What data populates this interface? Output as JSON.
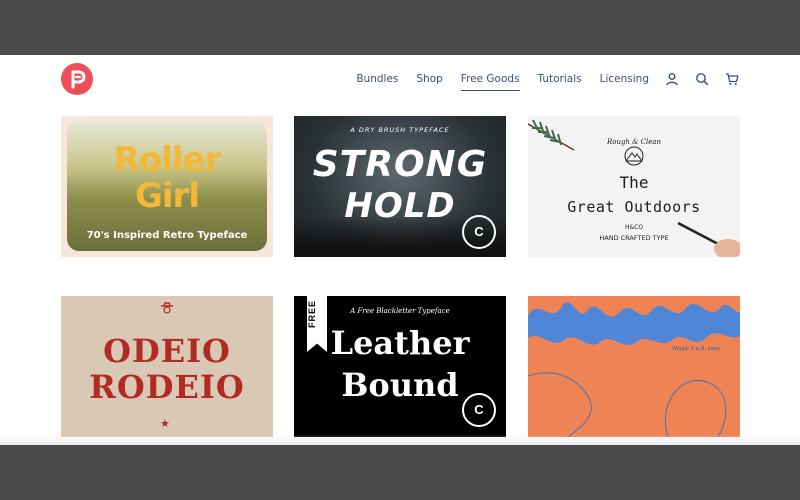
{
  "header": {
    "logo_alt": "P",
    "nav": [
      {
        "label": "Bundles",
        "active": false
      },
      {
        "label": "Shop",
        "active": false
      },
      {
        "label": "Free Goods",
        "active": true
      },
      {
        "label": "Tutorials",
        "active": false
      },
      {
        "label": "Licensing",
        "active": false
      }
    ],
    "icons": [
      "account-icon",
      "search-icon",
      "cart-icon"
    ]
  },
  "colors": {
    "brand": "#ef4f5a",
    "nav_text": "#3f4f7a",
    "page_bg": "#ffffff",
    "frame_bg": "#4a4a4a"
  },
  "products": [
    {
      "line1": "Roller",
      "line2": "Girl",
      "tagline": "70's Inspired Retro Typeface"
    },
    {
      "tagline": "A DRY BRUSH TYPEFACE",
      "line1": "STRONG",
      "line2": "HOLD"
    },
    {
      "tagline": "Rough & Clean",
      "line1": "The",
      "line2": "Great Outdoors",
      "credit": "H&CO",
      "tagline2": "HAND CRAFTED TYPE"
    },
    {
      "line1": "ODEIO",
      "line2": "RODEIO"
    },
    {
      "badge": "FREE",
      "tagline": "A Free Blackletter Typeface",
      "line1": "Leather",
      "line2": "Bound"
    },
    {
      "line1": "Wiggle",
      "tagline": "Wiggle it a lil, baby"
    }
  ]
}
